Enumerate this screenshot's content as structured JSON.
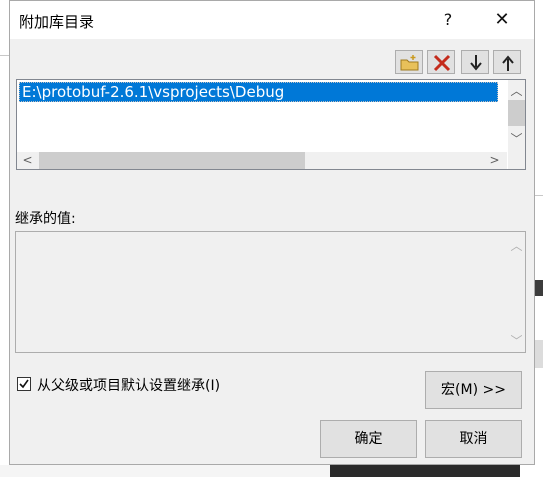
{
  "dialog": {
    "title": "附加库目录",
    "help_label": "?",
    "close_label": "✕"
  },
  "toolbar": {
    "buttons": [
      {
        "name": "new-folder-icon"
      },
      {
        "name": "delete-icon"
      },
      {
        "name": "move-down-icon"
      },
      {
        "name": "move-up-icon"
      }
    ]
  },
  "list": {
    "items": [
      "E:\\protobuf-2.6.1\\vsprojects\\Debug"
    ]
  },
  "inherited": {
    "label": "继承的值:"
  },
  "options": {
    "inherit_label": "从父级或项目默认设置继承(I)",
    "inherit_checked": true
  },
  "buttons": {
    "macro": "宏(M) >>",
    "ok": "确定",
    "cancel": "取消"
  },
  "colors": {
    "selection": "#0078d7",
    "dialog_bg": "#f0f0f0",
    "delete_red": "#c42b1c"
  }
}
